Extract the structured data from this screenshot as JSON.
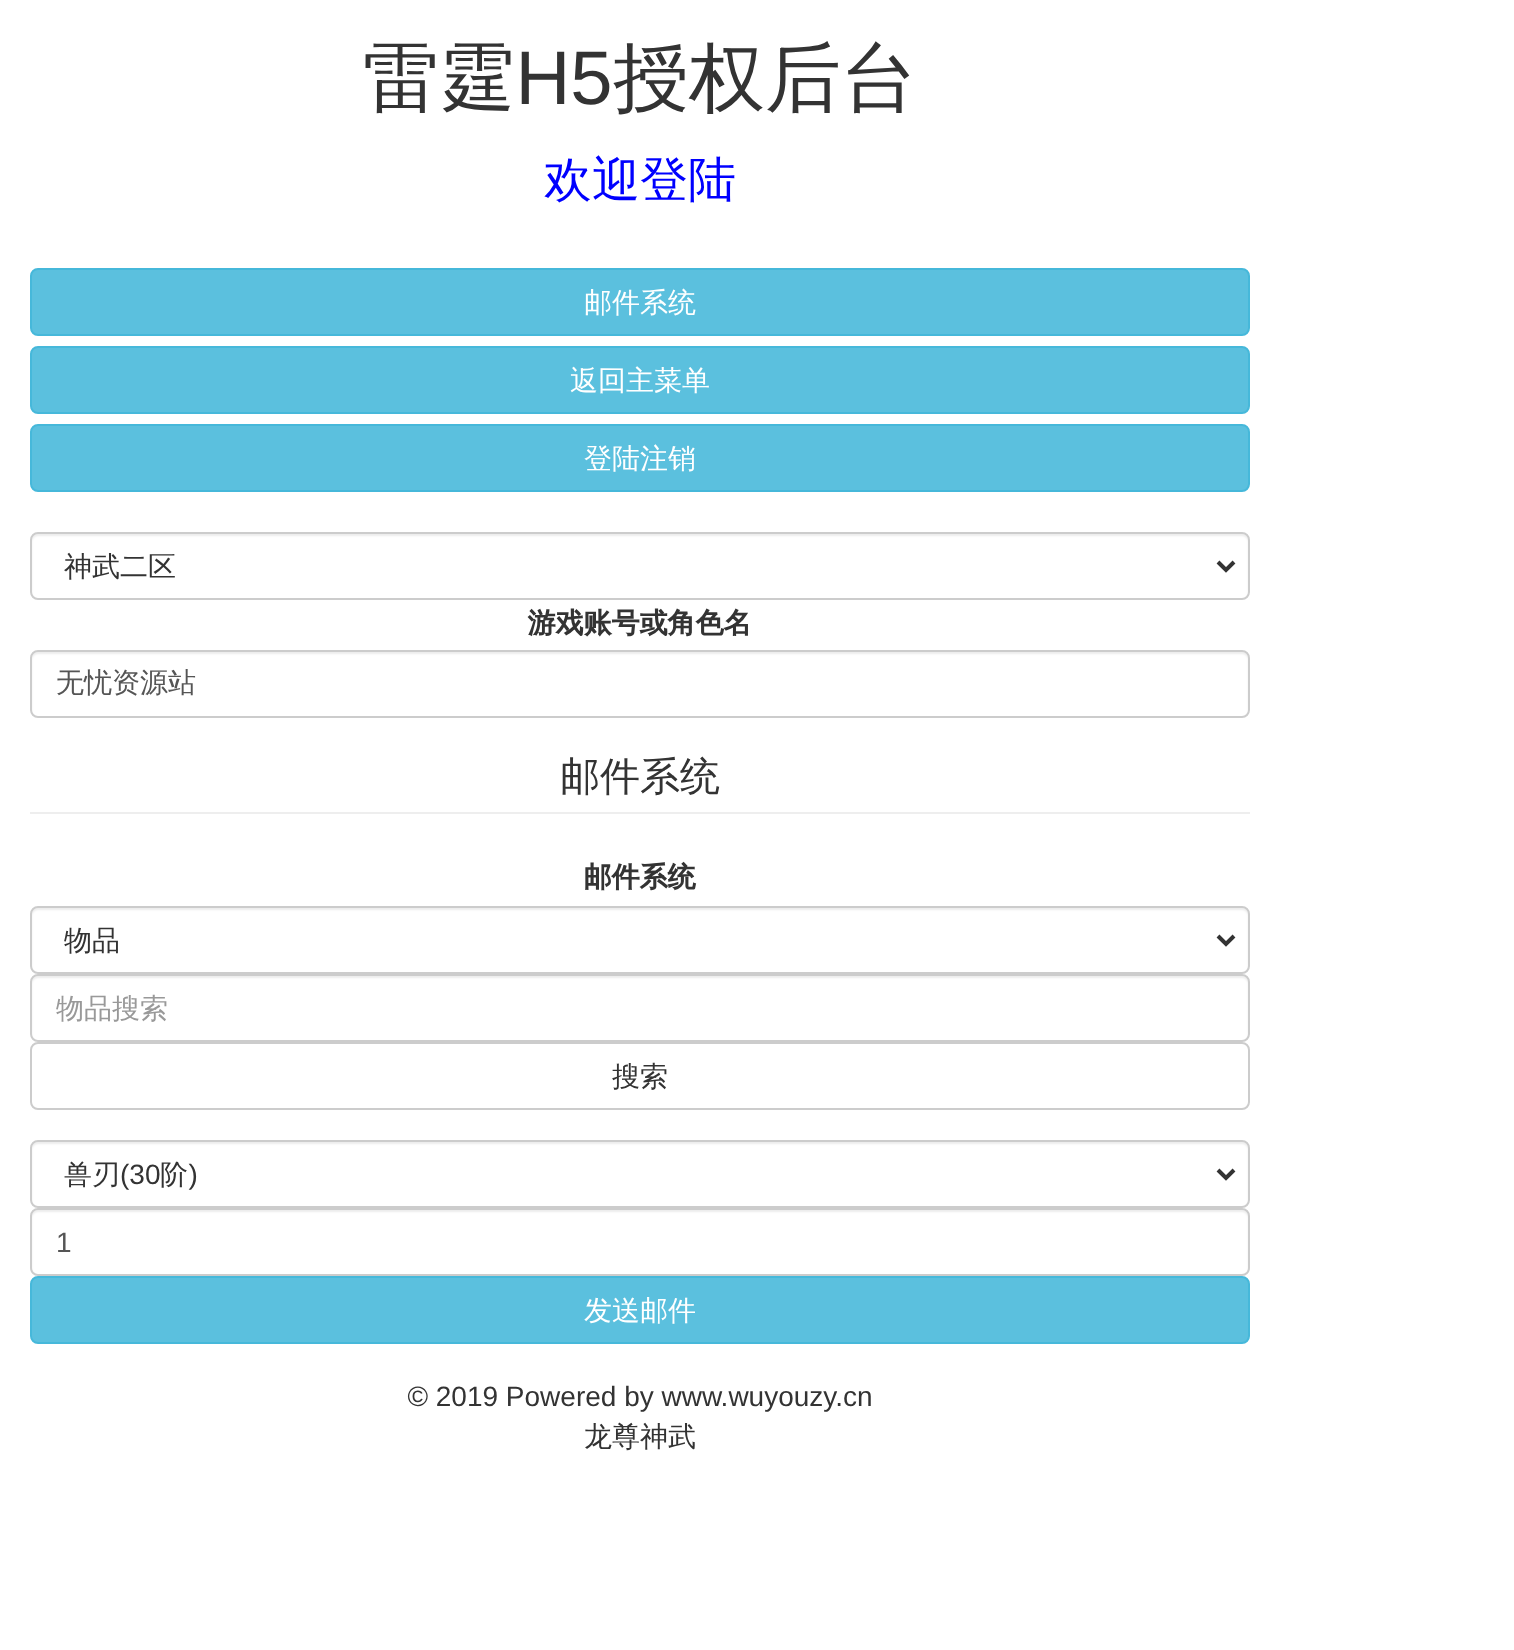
{
  "title": "雷霆H5授权后台",
  "subtitle": "欢迎登陆",
  "nav_buttons": [
    "邮件系统",
    "返回主菜单",
    "登陆注销"
  ],
  "server_select": {
    "value": "神武二区"
  },
  "account": {
    "label": "游戏账号或角色名",
    "value": "无忧资源站"
  },
  "section_heading": "邮件系统",
  "mail": {
    "label": "邮件系统",
    "category_select": {
      "value": "物品"
    },
    "search_field": {
      "placeholder": "物品搜索"
    },
    "search_button": "搜索",
    "item_select": {
      "value": "兽刃(30阶)"
    },
    "quantity_field": {
      "value": "1"
    },
    "send_button": "发送邮件"
  },
  "footer": [
    "© 2019 Powered by www.wuyouzy.cn",
    "龙尊神武"
  ]
}
